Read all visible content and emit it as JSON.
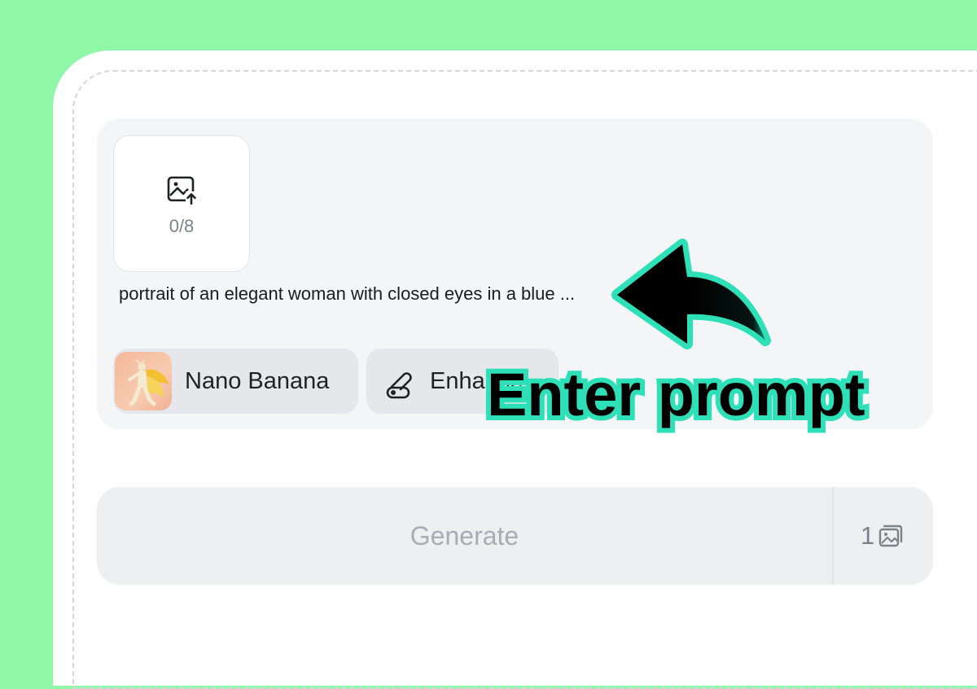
{
  "upload": {
    "count": "0/8",
    "icon": "image-upload-icon"
  },
  "prompt": {
    "text": "portrait of an elegant woman with closed eyes in a blue ..."
  },
  "model_chip": {
    "label": "Nano Banana",
    "thumbnail": "model-thumbnail"
  },
  "enhance_chip": {
    "label": "Enhance",
    "icon": "pencil-toggle-icon"
  },
  "generate": {
    "label": "Generate",
    "count": "1",
    "count_icon": "images-stack-icon"
  },
  "annotation": {
    "text": "Enter prompt",
    "stroke_color": "#2ee0b7"
  },
  "colors": {
    "background": "#8ef7a8",
    "panel": "#f4f5f7",
    "accent": "#2ee0b7"
  }
}
